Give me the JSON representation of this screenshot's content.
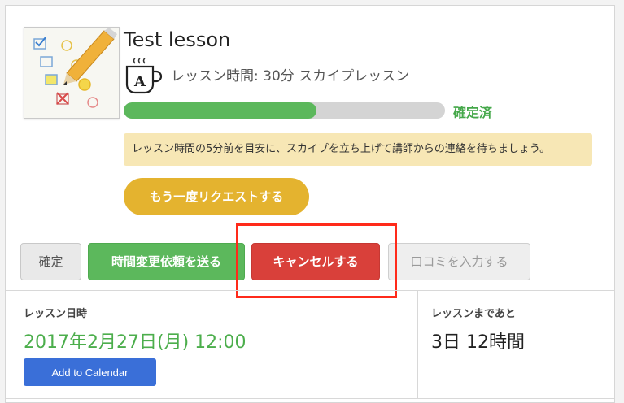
{
  "lesson": {
    "title": "Test lesson",
    "meta": "レッスン時間: 30分 スカイプレッスン",
    "status": "確定済",
    "progress": 0.6,
    "notice": "レッスン時間の5分前を目安に、スカイプを立ち上げて講師からの連絡を待ちましょう。",
    "rerequest_label": "もう一度リクエストする",
    "thumbnail_icon": "survey-pencil-icon",
    "type_icon": "coffee-cup-a-icon"
  },
  "actions": {
    "confirm_label": "確定",
    "change_label": "時間変更依頼を送る",
    "cancel_label": "キャンセルする",
    "review_label": "口コミを入力する"
  },
  "schedule": {
    "date_label": "レッスン日時",
    "date_value": "2017年2月27日(月) 12:00",
    "add_calendar_label": "Add to Calendar",
    "remain_label": "レッスンまであと",
    "remain_value": "3日 12時間"
  },
  "colors": {
    "green": "#5cb85c",
    "red": "#d9403a",
    "yellow": "#e4b32f",
    "blue": "#3a6fd8",
    "highlight": "#ff2a1a"
  }
}
